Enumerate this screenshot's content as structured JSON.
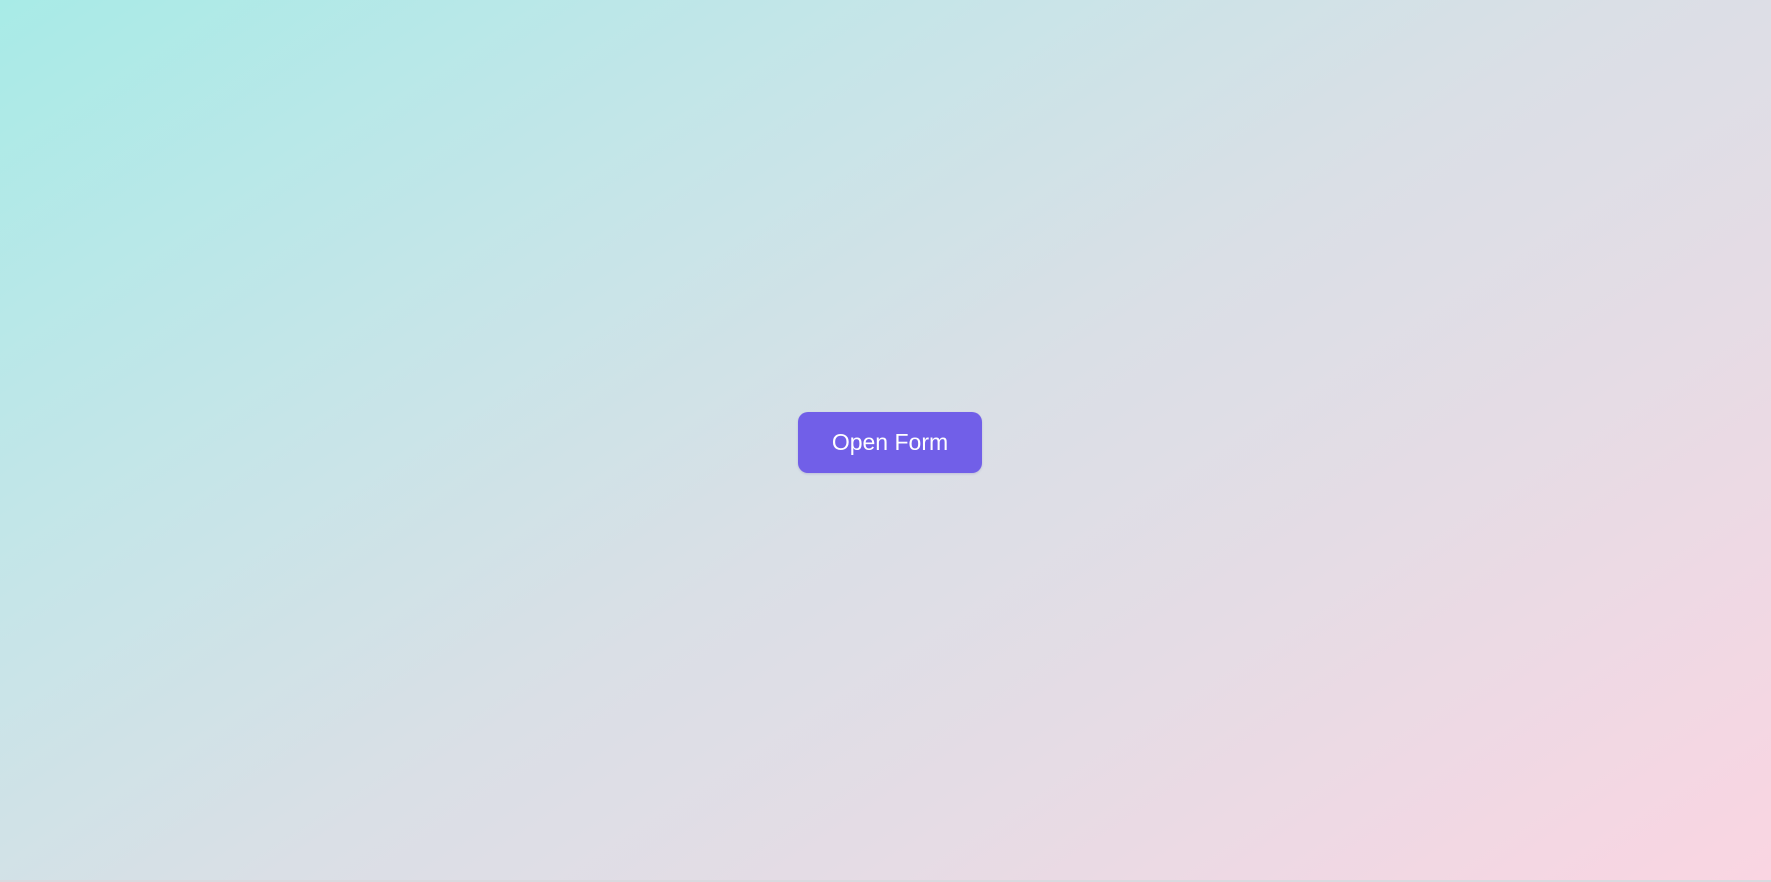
{
  "main": {
    "open_form_button_label": "Open Form"
  },
  "colors": {
    "accent": "#715fe8",
    "background_start": "#a8ebe7",
    "background_end": "#fad5e2",
    "button_text": "#ffffff"
  }
}
